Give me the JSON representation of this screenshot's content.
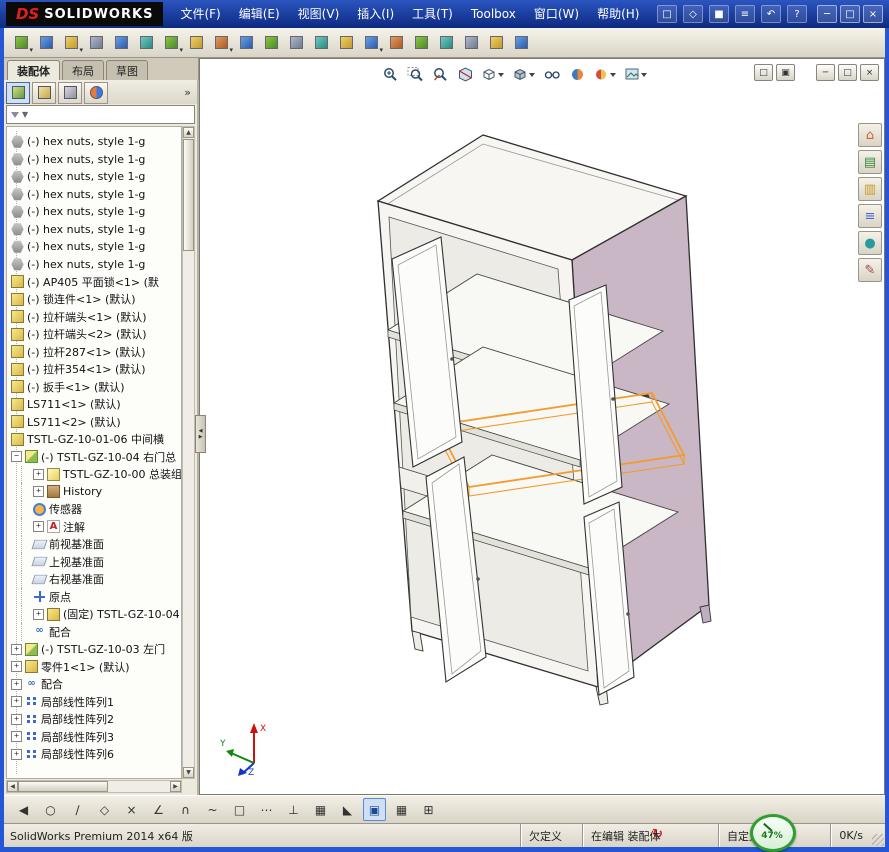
{
  "brand": {
    "mark": "DS",
    "name": "SOLIDWORKS"
  },
  "menus": [
    "文件(F)",
    "编辑(E)",
    "视图(V)",
    "插入(I)",
    "工具(T)",
    "Toolbox",
    "窗口(W)",
    "帮助(H)"
  ],
  "quick_icons": [
    {
      "name": "new-document-button",
      "g": "□"
    },
    {
      "name": "open-button",
      "g": "◇"
    },
    {
      "name": "save-button",
      "g": "■"
    },
    {
      "name": "print-button",
      "g": "≡"
    },
    {
      "name": "undo-button",
      "g": "↶"
    },
    {
      "name": "help-button",
      "g": "?"
    }
  ],
  "window_controls": [
    {
      "name": "minimize-button",
      "g": "─"
    },
    {
      "name": "restore-button",
      "g": "□"
    },
    {
      "name": "close-button",
      "g": "×"
    }
  ],
  "main_toolbar": [
    {
      "name": "insert-components",
      "cls": "v0 arr"
    },
    {
      "name": "mate",
      "cls": "v1"
    },
    {
      "name": "linear-component-pattern",
      "cls": "v2 arr"
    },
    {
      "name": "smart-fasteners",
      "cls": "v5"
    },
    {
      "name": "move-component",
      "cls": "v1"
    },
    {
      "name": "show-hidden-components",
      "cls": "v3"
    },
    {
      "name": "assembly-features",
      "cls": "v0 arr"
    },
    {
      "name": "reference-geometry",
      "cls": "v2"
    },
    {
      "name": "new-motion-study",
      "cls": "v4 arr"
    },
    {
      "name": "bill-of-materials",
      "cls": "v1"
    },
    {
      "name": "exploded-view",
      "cls": "v0"
    },
    {
      "name": "explode-line-sketch",
      "cls": "v5"
    },
    {
      "name": "interference-detection",
      "cls": "v3"
    },
    {
      "name": "clearance-verification",
      "cls": "v2"
    },
    {
      "name": "hole-alignment",
      "cls": "v1 arr"
    },
    {
      "name": "assembly-visualization",
      "cls": "v4"
    },
    {
      "name": "instant3d",
      "cls": "v0"
    },
    {
      "name": "update-speedpak",
      "cls": "v3"
    },
    {
      "name": "take-snapshot",
      "cls": "v5"
    },
    {
      "name": "isolate",
      "cls": "v2"
    },
    {
      "name": "assembly-settings",
      "cls": "v1"
    }
  ],
  "doc_tabs": [
    {
      "name": "tab-assembly",
      "label": "装配体",
      "cls": "active"
    },
    {
      "name": "tab-layout",
      "label": "布局"
    },
    {
      "name": "tab-sketch",
      "label": "草图"
    }
  ],
  "panel": {
    "header_icons": [
      {
        "name": "featuremanager-tree-tab",
        "cls": "ph0 active"
      },
      {
        "name": "propertymanager-tab",
        "cls": "ph1"
      },
      {
        "name": "configurationmanager-tab",
        "cls": "ph2"
      },
      {
        "name": "dimxpertmanager-tab",
        "cls": "ph3"
      }
    ],
    "overflow": "»"
  },
  "glyphs": {
    "up": "▲",
    "down": "▼",
    "left": "◀",
    "right": "▶",
    "dropdown": "▼",
    "overflow": "»",
    "filter": "▼"
  },
  "tree": {
    "items": [
      {
        "label": "(-) hex nuts, style 1-g",
        "icon": "nut"
      },
      {
        "label": "(-) hex nuts, style 1-g",
        "icon": "nut"
      },
      {
        "label": "(-) hex nuts, style 1-g",
        "icon": "nut"
      },
      {
        "label": "(-) hex nuts, style 1-g",
        "icon": "nut"
      },
      {
        "label": "(-) hex nuts, style 1-g",
        "icon": "nut"
      },
      {
        "label": "(-) hex nuts, style 1-g",
        "icon": "nut"
      },
      {
        "label": "(-) hex nuts, style 1-g",
        "icon": "nut"
      },
      {
        "label": "(-) hex nuts, style 1-g",
        "icon": "nut"
      },
      {
        "label": "(-) AP405 平面锁<1> (默",
        "icon": "part"
      },
      {
        "label": "(-) 锁连件<1> (默认)",
        "icon": "part"
      },
      {
        "label": "(-) 拉杆端头<1> (默认)",
        "icon": "part"
      },
      {
        "label": "(-) 拉杆端头<2> (默认)",
        "icon": "part"
      },
      {
        "label": "(-) 拉杆287<1> (默认)",
        "icon": "part"
      },
      {
        "label": "(-) 拉杆354<1> (默认)",
        "icon": "part"
      },
      {
        "label": "(-) 扳手<1> (默认)",
        "icon": "part"
      },
      {
        "label": "LS711<1> (默认)",
        "icon": "part"
      },
      {
        "label": "LS711<2> (默认)",
        "icon": "part"
      },
      {
        "label": "TSTL-GZ-10-01-06 中间横",
        "icon": "part"
      },
      {
        "label": "(-) TSTL-GZ-10-04 右门总",
        "icon": "asm",
        "expand": "minus"
      },
      {
        "label": "TSTL-GZ-10-00 总装组",
        "icon": "note",
        "expand": "plus",
        "cls": "indent"
      },
      {
        "label": "History",
        "icon": "hist",
        "expand": "plus",
        "cls": "indent"
      },
      {
        "label": "传感器",
        "icon": "sensor",
        "cls": "indent"
      },
      {
        "label": "注解",
        "icon": "ann",
        "expand": "plus",
        "cls": "indent"
      },
      {
        "label": "前视基准面",
        "icon": "plane",
        "cls": "indent"
      },
      {
        "label": "上视基准面",
        "icon": "plane",
        "cls": "indent"
      },
      {
        "label": "右视基准面",
        "icon": "plane",
        "cls": "indent"
      },
      {
        "label": "原点",
        "icon": "origin",
        "cls": "indent"
      },
      {
        "label": "(固定) TSTL-GZ-10-04",
        "icon": "part",
        "expand": "plus",
        "cls": "indent"
      },
      {
        "label": "配合",
        "icon": "mate",
        "cls": "indent"
      },
      {
        "label": "(-) TSTL-GZ-10-03 左门",
        "icon": "asm",
        "expand": "plus"
      },
      {
        "label": "零件1<1> (默认)",
        "icon": "part",
        "expand": "plus"
      },
      {
        "label": "配合",
        "icon": "mate",
        "expand": "plus"
      },
      {
        "label": "局部线性阵列1",
        "icon": "pattern",
        "expand": "plus"
      },
      {
        "label": "局部线性阵列2",
        "icon": "pattern",
        "expand": "plus"
      },
      {
        "label": "局部线性阵列3",
        "icon": "pattern",
        "expand": "plus"
      },
      {
        "label": "局部线性阵列6",
        "icon": "pattern",
        "expand": "plus"
      }
    ]
  },
  "viewport": {
    "view_toolbar": [
      "zoom-to-fit",
      "zoom-to-area",
      "zoom-to-selection",
      "section-view",
      "view-orientation",
      "display-style",
      "hide-show-items",
      "realview-graphics",
      "edit-appearance",
      "apply-scene"
    ],
    "doc_controls": [
      {
        "name": "doc-restore-button",
        "g": "□"
      },
      {
        "name": "doc-cascade-button",
        "g": "▣"
      },
      {
        "name": "doc-minimize-button",
        "g": "─",
        "cls": "gap"
      },
      {
        "name": "doc-maximize-button",
        "g": "□"
      },
      {
        "name": "doc-close-button",
        "g": "×"
      }
    ],
    "right_toolbar": [
      {
        "name": "task-pane-home",
        "g": "⌂",
        "color": "#d2622a"
      },
      {
        "name": "design-library",
        "g": "▤",
        "color": "#3a8a3a"
      },
      {
        "name": "file-explorer",
        "g": "▥",
        "color": "#c89a20"
      },
      {
        "name": "view-palette",
        "g": "≡",
        "color": "#4a6ad0"
      },
      {
        "name": "appearances-scenes",
        "g": "●",
        "color": "#2a9aa0"
      },
      {
        "name": "custom-properties",
        "g": "✎",
        "color": "#a04a4a"
      }
    ],
    "triad": {
      "x": "X",
      "y": "Y",
      "z": "Z"
    }
  },
  "sketch_toolbar": [
    {
      "name": "toolbar-scroll-left",
      "g": "◀"
    },
    {
      "name": "circle-tool",
      "g": "○"
    },
    {
      "name": "line-tool",
      "g": "∕"
    },
    {
      "name": "polygon-tool",
      "g": "◇"
    },
    {
      "name": "trim-entities-tool",
      "g": "×"
    },
    {
      "name": "angle-dimension-tool",
      "g": "∠"
    },
    {
      "name": "arc-tool",
      "g": "∩"
    },
    {
      "name": "spline-tool",
      "g": "~"
    },
    {
      "name": "rectangle-tool",
      "g": "□"
    },
    {
      "name": "point-tool",
      "g": "⋯"
    },
    {
      "name": "mirror-entities-tool",
      "g": "⊥"
    },
    {
      "name": "hatch-tool",
      "g": "▦"
    },
    {
      "name": "triangle-tool",
      "g": "◣"
    },
    {
      "name": "shaded-view-tool",
      "g": "▣",
      "cls": "sel"
    },
    {
      "name": "grid-tool",
      "g": "▦"
    },
    {
      "name": "table-tool",
      "g": "⊞"
    }
  ],
  "statusbar": {
    "product": "SolidWorks Premium 2014 x64 版",
    "state": "欠定义",
    "editing": "在编辑 装配体",
    "custom": "自定义",
    "gauge": "47%",
    "speed": "0K/s"
  },
  "colors": {
    "accent_blue": "#2456d6",
    "cabinet_side_pink": "#c9b7c6",
    "selection_orange": "#f49b2a",
    "gauge_green": "#2f9e2f"
  }
}
